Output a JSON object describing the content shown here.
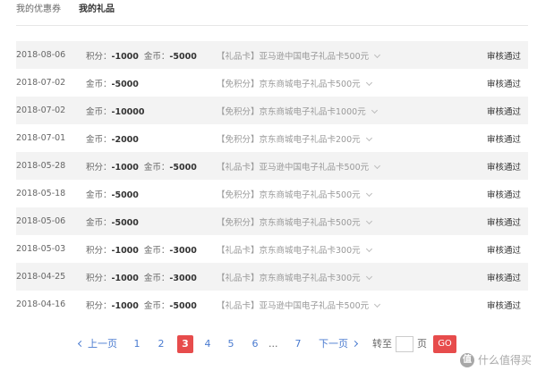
{
  "tabs": [
    {
      "label": "我的优惠券"
    },
    {
      "label": "我的礼品"
    }
  ],
  "rows": [
    {
      "date": "2018-08-06",
      "costs": [
        {
          "label": "积分：",
          "value": "-1000"
        },
        {
          "label": "金币：",
          "value": "-5000"
        }
      ],
      "tag": "【礼品卡】",
      "product": "亚马逊中国电子礼品卡500元",
      "status": "审核通过"
    },
    {
      "date": "2018-07-02",
      "costs": [
        {
          "label": "金币：",
          "value": "-5000"
        }
      ],
      "tag": "【免积分】",
      "product": "京东商城电子礼品卡500元",
      "status": "审核通过"
    },
    {
      "date": "2018-07-02",
      "costs": [
        {
          "label": "金币：",
          "value": "-10000"
        }
      ],
      "tag": "【免积分】",
      "product": "京东商城电子礼品卡1000元",
      "status": "审核通过"
    },
    {
      "date": "2018-07-01",
      "costs": [
        {
          "label": "金币：",
          "value": "-2000"
        }
      ],
      "tag": "【免积分】",
      "product": "京东商城电子礼品卡200元",
      "status": "审核通过"
    },
    {
      "date": "2018-05-28",
      "costs": [
        {
          "label": "积分：",
          "value": "-1000"
        },
        {
          "label": "金币：",
          "value": "-5000"
        }
      ],
      "tag": "【礼品卡】",
      "product": "亚马逊中国电子礼品卡500元",
      "status": "审核通过"
    },
    {
      "date": "2018-05-18",
      "costs": [
        {
          "label": "金币：",
          "value": "-5000"
        }
      ],
      "tag": "【免积分】",
      "product": "京东商城电子礼品卡500元",
      "status": "审核通过"
    },
    {
      "date": "2018-05-06",
      "costs": [
        {
          "label": "金币：",
          "value": "-5000"
        }
      ],
      "tag": "【免积分】",
      "product": "京东商城电子礼品卡500元",
      "status": "审核通过"
    },
    {
      "date": "2018-05-03",
      "costs": [
        {
          "label": "积分：",
          "value": "-1000"
        },
        {
          "label": "金币：",
          "value": "-3000"
        }
      ],
      "tag": "【礼品卡】",
      "product": "京东商城电子礼品卡300元",
      "status": "审核通过"
    },
    {
      "date": "2018-04-25",
      "costs": [
        {
          "label": "积分：",
          "value": "-1000"
        },
        {
          "label": "金币：",
          "value": "-3000"
        }
      ],
      "tag": "【礼品卡】",
      "product": "京东商城电子礼品卡300元",
      "status": "审核通过"
    },
    {
      "date": "2018-04-16",
      "costs": [
        {
          "label": "积分：",
          "value": "-1000"
        },
        {
          "label": "金币：",
          "value": "-5000"
        }
      ],
      "tag": "【礼品卡】",
      "product": "亚马逊中国电子礼品卡500元",
      "status": "审核通过"
    }
  ],
  "pagination": {
    "prev_label": "上一页",
    "pages": [
      "1",
      "2",
      "3",
      "4",
      "5",
      "6"
    ],
    "current_page": "3",
    "ellipsis": "...",
    "last_page": "7",
    "next_label": "下一页",
    "goto_label": "转至",
    "page_unit": "页",
    "go_label": "GO"
  },
  "watermark": {
    "badge": "值",
    "text": "什么值得买"
  },
  "colors": {
    "accent_red": "#e74c4c",
    "link_blue": "#4a7bd0",
    "row_stripe": "#f3f3f3"
  },
  "icons": {
    "row_expand": "chevron-down-icon",
    "prev": "chevron-left-icon",
    "next": "chevron-right-icon"
  }
}
